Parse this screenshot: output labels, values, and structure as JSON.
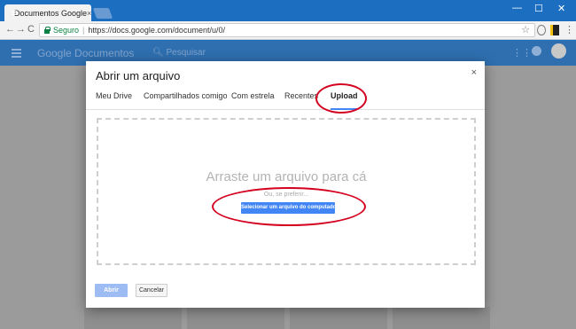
{
  "browser": {
    "tab_title": "Documentos Google",
    "tab_close": "×",
    "back": "←",
    "forward": "→",
    "reload": "C",
    "secure_label": "Seguro",
    "separator": "|",
    "url": "https://docs.google.com/document/u/0/",
    "star": "☆",
    "minimize": "—",
    "maximize": "☐",
    "close": "✕"
  },
  "app": {
    "title": "Google Documentos",
    "search_placeholder": "Pesquisar"
  },
  "dialog": {
    "title": "Abrir um arquivo",
    "close": "×",
    "tabs": [
      {
        "label": "Meu Drive"
      },
      {
        "label": "Compartilhados comigo"
      },
      {
        "label": "Com estrela"
      },
      {
        "label": "Recentes"
      },
      {
        "label": "Upload"
      }
    ],
    "active_tab": "Upload",
    "drop_title": "Arraste um arquivo para cá",
    "drop_or": "Ou, se preferir...",
    "select_button": "Selecionar um arquivo do computador",
    "open_button": "Abrir",
    "cancel_button": "Cancelar"
  },
  "colors": {
    "accent": "#4285f4",
    "annotation": "#d4001f",
    "secure": "#0b8043"
  }
}
